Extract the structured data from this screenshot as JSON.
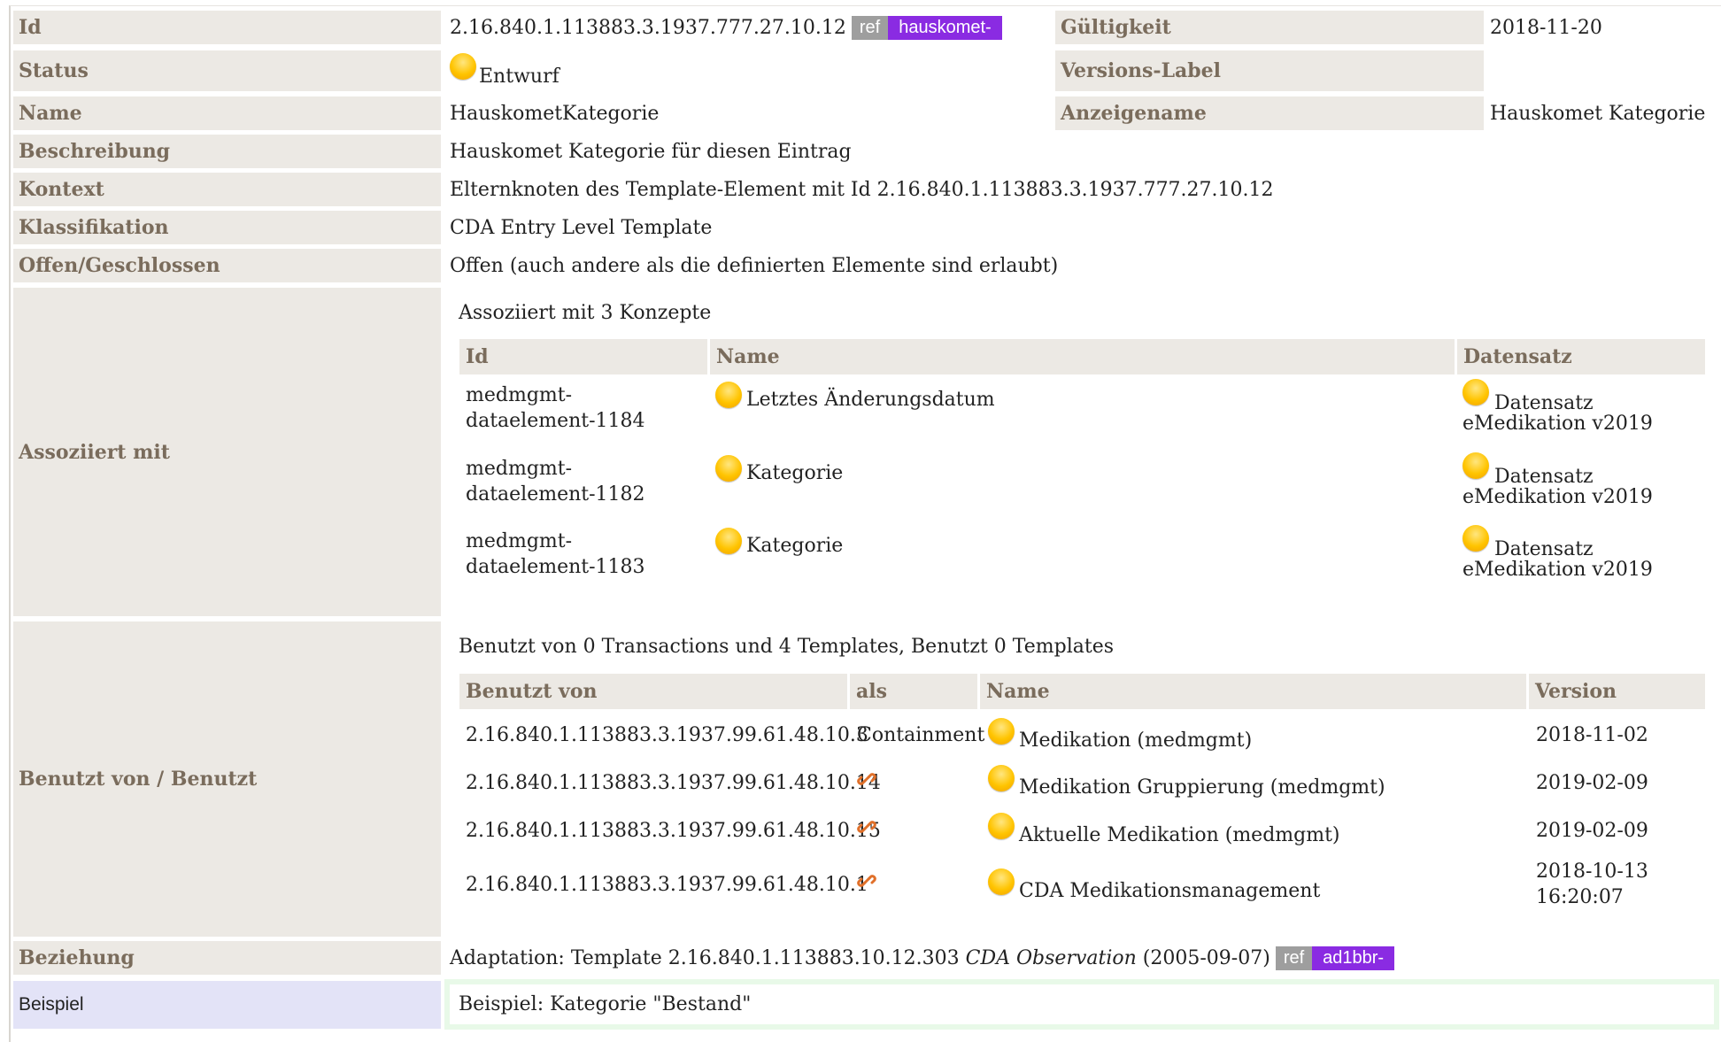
{
  "rows": {
    "id": {
      "label": "Id",
      "value": "2.16.840.1.113883.3.1937.777.27.10.12",
      "ref": "ref",
      "tag": "hauskomet-"
    },
    "validity": {
      "label": "Gültigkeit",
      "value": "2018-11-20"
    },
    "status": {
      "label": "Status",
      "value": "Entwurf"
    },
    "version_label": {
      "label": "Versions-Label",
      "value": ""
    },
    "name": {
      "label": "Name",
      "value": "HauskometKategorie"
    },
    "display_name": {
      "label": "Anzeigename",
      "value": "Hauskomet Kategorie"
    },
    "description": {
      "label": "Beschreibung",
      "value": "Hauskomet Kategorie für diesen Eintrag"
    },
    "context": {
      "label": "Kontext",
      "value": "Elternknoten des Template-Element mit Id 2.16.840.1.113883.3.1937.777.27.10.12"
    },
    "classification": {
      "label": "Klassifikation",
      "value": "CDA Entry Level Template"
    },
    "open_closed": {
      "label": "Offen/Geschlossen",
      "value": "Offen (auch andere als die definierten Elemente sind erlaubt)"
    }
  },
  "associated": {
    "label": "Assoziiert mit",
    "summary": "Assoziiert mit 3 Konzepte",
    "headers": [
      "Id",
      "Name",
      "Datensatz"
    ],
    "items": [
      {
        "id_line1": "medmgmt-",
        "id_line2": "dataelement-1184",
        "name": "Letztes Änderungsdatum",
        "ds_line1": "Datensatz",
        "ds_line2": "eMedikation v2019"
      },
      {
        "id_line1": "medmgmt-",
        "id_line2": "dataelement-1182",
        "name": "Kategorie",
        "ds_line1": "Datensatz",
        "ds_line2": "eMedikation v2019"
      },
      {
        "id_line1": "medmgmt-",
        "id_line2": "dataelement-1183",
        "name": "Kategorie",
        "ds_line1": "Datensatz",
        "ds_line2": "eMedikation v2019"
      }
    ]
  },
  "used_by": {
    "label": "Benutzt von / Benutzt",
    "summary": "Benutzt von 0 Transactions und 4 Templates, Benutzt 0 Templates",
    "headers": [
      "Benutzt von",
      "als",
      "Name",
      "Version"
    ],
    "items": [
      {
        "id": "2.16.840.1.113883.3.1937.99.61.48.10.3",
        "as": "Containment",
        "name": "Medikation (medmgmt)",
        "version": "2018-11-02",
        "version2": ""
      },
      {
        "id": "2.16.840.1.113883.3.1937.99.61.48.10.14",
        "as": "",
        "name": "Medikation Gruppierung (medmgmt)",
        "version": "2019-02-09",
        "version2": ""
      },
      {
        "id": "2.16.840.1.113883.3.1937.99.61.48.10.15",
        "as": "",
        "name": "Aktuelle Medikation (medmgmt)",
        "version": "2019-02-09",
        "version2": ""
      },
      {
        "id": "2.16.840.1.113883.3.1937.99.61.48.10.1",
        "as": "",
        "name": "CDA Medikationsmanagement",
        "version": "2018-10-13",
        "version2": "16:20:07"
      }
    ]
  },
  "relationship": {
    "label": "Beziehung",
    "prefix": "Adaptation: Template 2.16.840.1.113883.10.12.303",
    "template_name": "CDA Observation",
    "date": "(2005-09-07)",
    "ref": "ref",
    "tag": "ad1bbr-"
  },
  "example": {
    "label": "Beispiel",
    "value": "Beispiel: Kategorie \"Bestand\""
  },
  "icons": {
    "status": "yellow-circle-icon",
    "containment_link": "chain-link-icon"
  },
  "colors": {
    "header_bg": "#ece9e4",
    "header_text": "#7a6c5c",
    "tag_purple": "#8a2be2",
    "ref_gray": "#9e9e9e",
    "example_label_bg": "#e3e3f7",
    "example_border": "#e8f9e8"
  }
}
